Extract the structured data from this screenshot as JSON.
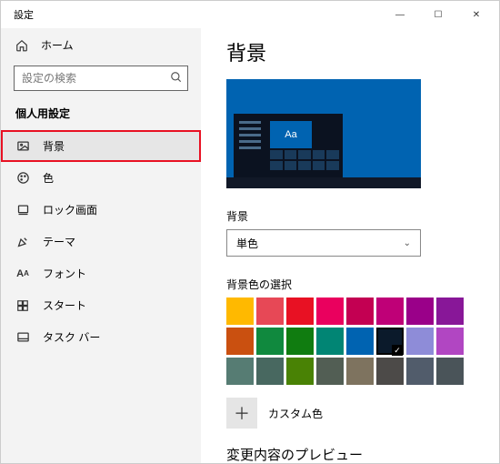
{
  "window": {
    "title": "設定"
  },
  "winControls": {
    "min": "—",
    "max": "☐",
    "close": "✕"
  },
  "home": {
    "label": "ホーム"
  },
  "search": {
    "placeholder": "設定の検索"
  },
  "sectionTitle": "個人用設定",
  "nav": {
    "background": "背景",
    "color": "色",
    "lock": "ロック画面",
    "theme": "テーマ",
    "font": "フォント",
    "start": "スタート",
    "taskbar": "タスク バー"
  },
  "main": {
    "heading": "背景",
    "previewTileText": "Aa",
    "bgLabel": "背景",
    "bgSelectValue": "単色",
    "swatchLabel": "背景色の選択",
    "colors": [
      "#ffb900",
      "#e74856",
      "#e81123",
      "#ea005e",
      "#c30052",
      "#bf0077",
      "#9a0089",
      "#881798",
      "#ca5010",
      "#10893e",
      "#107c10",
      "#018574",
      "#0063b1",
      "#0b1a2b",
      "#8e8cd8",
      "#b146c2",
      "#567c73",
      "#486860",
      "#498205",
      "#525e54",
      "#7e735f",
      "#4c4a48",
      "#515c6b",
      "#4a5459"
    ],
    "selectedColorIndex": 13,
    "customColor": "カスタム色",
    "previewHeading": "変更内容のプレビュー"
  }
}
